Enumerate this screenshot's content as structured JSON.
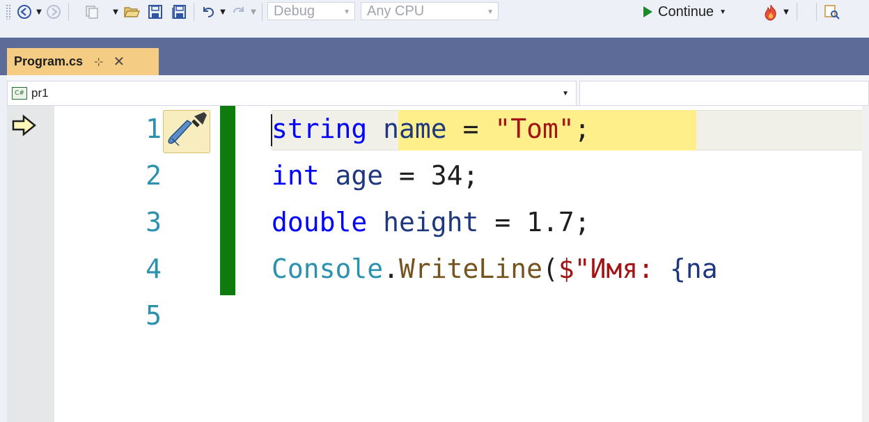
{
  "toolbar": {
    "config_combo": "Debug",
    "platform_combo": "Any CPU",
    "continue_label": "Continue"
  },
  "tabs": [
    {
      "label": "Program.cs",
      "active": true
    }
  ],
  "navbar": {
    "project": "pr1",
    "project_icon_text": "C#"
  },
  "editor": {
    "line_numbers": [
      "1",
      "2",
      "3",
      "4",
      "5"
    ],
    "current_line": 1,
    "lines": [
      [
        {
          "t": "string",
          "c": "kw"
        },
        {
          "t": " name ",
          "c": "var"
        },
        {
          "t": "=",
          "c": "op"
        },
        {
          "t": " \"Tom\"",
          "c": "str"
        },
        {
          "t": ";",
          "c": "op"
        }
      ],
      [
        {
          "t": "int",
          "c": "kw"
        },
        {
          "t": " age ",
          "c": "var"
        },
        {
          "t": "=",
          "c": "op"
        },
        {
          "t": " 34;",
          "c": "op"
        }
      ],
      [
        {
          "t": "double",
          "c": "kw"
        },
        {
          "t": " height ",
          "c": "var"
        },
        {
          "t": "=",
          "c": "op"
        },
        {
          "t": " 1.7;",
          "c": "op"
        }
      ],
      [
        {
          "t": "Console",
          "c": "cls"
        },
        {
          "t": ".",
          "c": "op"
        },
        {
          "t": "WriteLine",
          "c": "mth"
        },
        {
          "t": "(",
          "c": "op"
        },
        {
          "t": "$\"Имя: ",
          "c": "str"
        },
        {
          "t": "{na",
          "c": "var"
        }
      ],
      []
    ]
  },
  "colors": {
    "tab_active_bg": "#f5cc84",
    "tabstrip_bg": "#5d6b99",
    "change_bar": "#0f7b0f",
    "statement_highlight": "#ffef8a"
  }
}
